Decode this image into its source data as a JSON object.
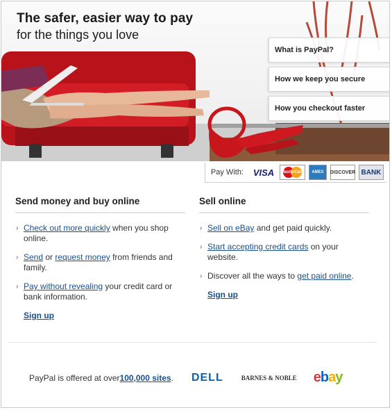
{
  "hero": {
    "title": "The safer, easier way to pay",
    "subtitle": "for the things you love",
    "menu": [
      {
        "label": "What is PayPal?"
      },
      {
        "label": "How we keep you secure"
      },
      {
        "label": "How you checkout faster"
      }
    ]
  },
  "pay_with": {
    "label": "Pay With:",
    "cards": [
      "VISA",
      "MasterCard",
      "AMEX",
      "DISCOVER",
      "BANK"
    ]
  },
  "left": {
    "heading": "Send money and buy online",
    "items": [
      {
        "link": "Check out more quickly",
        "text": " when you shop online."
      },
      {
        "link1": "Send",
        "mid": " or ",
        "link2": "request money",
        "text": " from friends and family."
      },
      {
        "link": "Pay without revealing",
        "text": " your credit card or bank information."
      }
    ],
    "signup": "Sign up"
  },
  "right": {
    "heading": "Sell online",
    "items": [
      {
        "link": "Sell on eBay",
        "text": " and get paid quickly."
      },
      {
        "link": "Start accepting credit cards",
        "text": " on your website."
      },
      {
        "pre": "Discover all the ways to ",
        "link": "get paid online",
        "text": "."
      }
    ],
    "signup": "Sign up"
  },
  "footer": {
    "text": "PayPal is offered at over ",
    "link": "100,000 sites",
    "end": ".",
    "logos": [
      "DELL",
      "BARNES & NOBLE",
      "ebay"
    ]
  },
  "colors": {
    "link": "#1a4f8b",
    "sofa": "#c8161d",
    "visa": "#1a1f71"
  }
}
